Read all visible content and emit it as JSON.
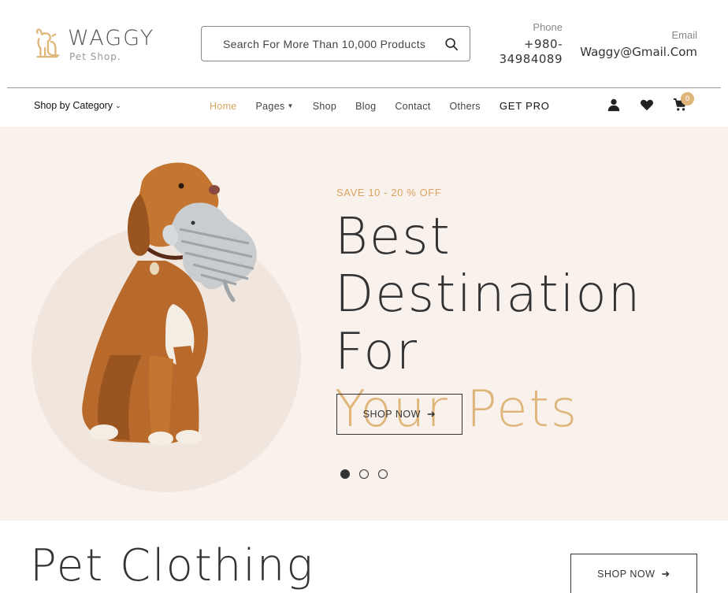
{
  "brand": {
    "name": "WAGGY",
    "tagline": "Pet Shop."
  },
  "search": {
    "placeholder": "Search For More Than 10,000 Products"
  },
  "contact": {
    "phone_label": "Phone",
    "phone_value": "+980-\n34984089",
    "email_label": "Email",
    "email_value": "Waggy@Gmail.Com"
  },
  "nav": {
    "category": "Shop by Category",
    "items": [
      {
        "label": "Home",
        "active": true
      },
      {
        "label": "Pages"
      },
      {
        "label": "Shop"
      },
      {
        "label": "Blog"
      },
      {
        "label": "Contact"
      },
      {
        "label": "Others"
      },
      {
        "label": "GET PRO"
      }
    ],
    "icons": [
      "user-icon",
      "heart-icon",
      "cart-icon"
    ],
    "cart_count": "0"
  },
  "hero": {
    "eyebrow": "SAVE 10 - 20 % OFF",
    "headline_line1": "Best",
    "headline_line2": "Destination For",
    "headline_accent": "Your Pets",
    "cta": "SHOP NOW",
    "slides_total": 3,
    "active_slide": 1
  },
  "section": {
    "title": "Pet Clothing",
    "cta": "SHOP NOW"
  },
  "colors": {
    "accent": "#dfb57a",
    "hero_bg": "#f8f1ec",
    "text": "#333333"
  }
}
